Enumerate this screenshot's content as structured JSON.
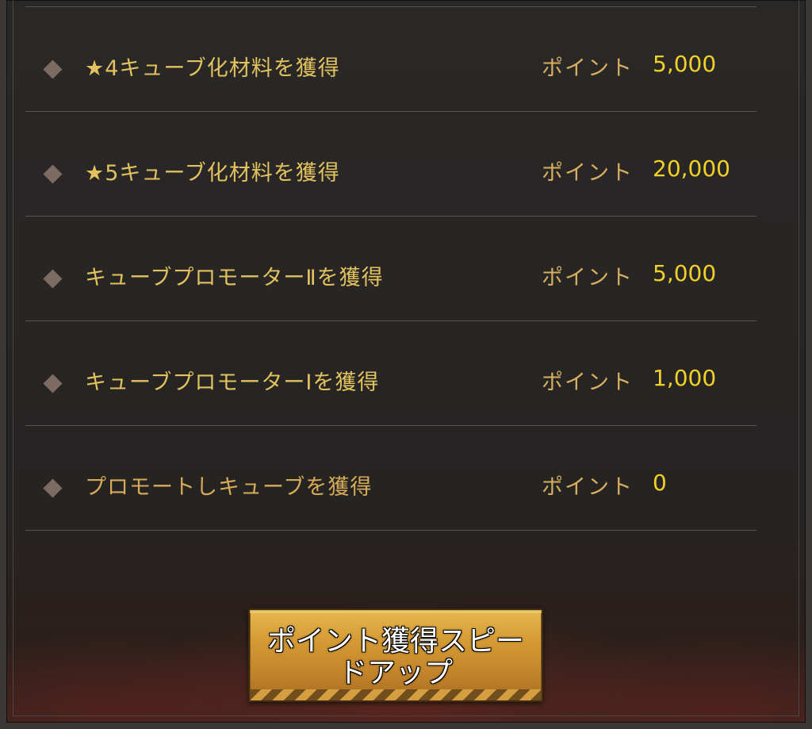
{
  "reward_list": [
    {
      "label": "★4キューブ化材料を獲得",
      "points_label": "ポイント",
      "points_value": "5,000"
    },
    {
      "label": "★5キューブ化材料を獲得",
      "points_label": "ポイント",
      "points_value": "20,000"
    },
    {
      "label": "キューブプロモーターⅡを獲得",
      "points_label": "ポイント",
      "points_value": "5,000"
    },
    {
      "label": "キューブプロモーターⅠを獲得",
      "points_label": "ポイント",
      "points_value": "1,000"
    },
    {
      "label": "プロモートしキューブを獲得",
      "points_label": "ポイント",
      "points_value": "0"
    }
  ],
  "speed_up_button": {
    "label": "ポイント獲得スピードアップ"
  },
  "colors": {
    "label": "#e1c25f",
    "points_label": "#d8af5f",
    "points_value": "#f1d027",
    "button": "#d49a34",
    "diamond": "#7d6a61"
  },
  "icons": {
    "bullet": "diamond-bullet-icon"
  }
}
